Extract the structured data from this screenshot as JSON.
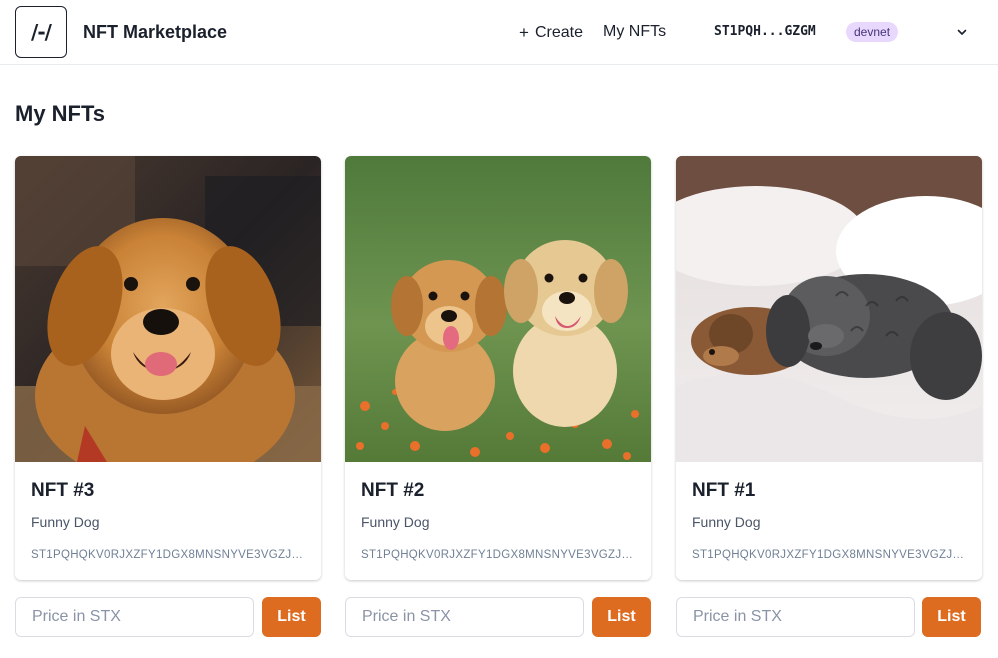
{
  "header": {
    "logo_text": "/-/",
    "title": "NFT Marketplace",
    "create_label": "Create",
    "create_icon": "plus-icon",
    "my_nfts_label": "My NFTs",
    "wallet_address": "ST1PQH...GZGM",
    "network_badge": "devnet",
    "menu_icon": "chevron-down-icon"
  },
  "page": {
    "heading": "My NFTs"
  },
  "colors": {
    "accent": "#dd6b20",
    "badge_bg": "#e9d8fd",
    "badge_text": "#44337a"
  },
  "nfts": [
    {
      "title": "NFT #3",
      "description": "Funny Dog",
      "owner": "ST1PQHQKV0RJXZFY1DGX8MNSNYVE3VGZJSRTPGZGM",
      "price_placeholder": "Price in STX",
      "list_label": "List"
    },
    {
      "title": "NFT #2",
      "description": "Funny Dog",
      "owner": "ST1PQHQKV0RJXZFY1DGX8MNSNYVE3VGZJSRTPGZGM",
      "price_placeholder": "Price in STX",
      "list_label": "List"
    },
    {
      "title": "NFT #1",
      "description": "Funny Dog",
      "owner": "ST1PQHQKV0RJXZFY1DGX8MNSNYVE3VGZJSRTPGZGM",
      "price_placeholder": "Price in STX",
      "list_label": "List"
    }
  ]
}
